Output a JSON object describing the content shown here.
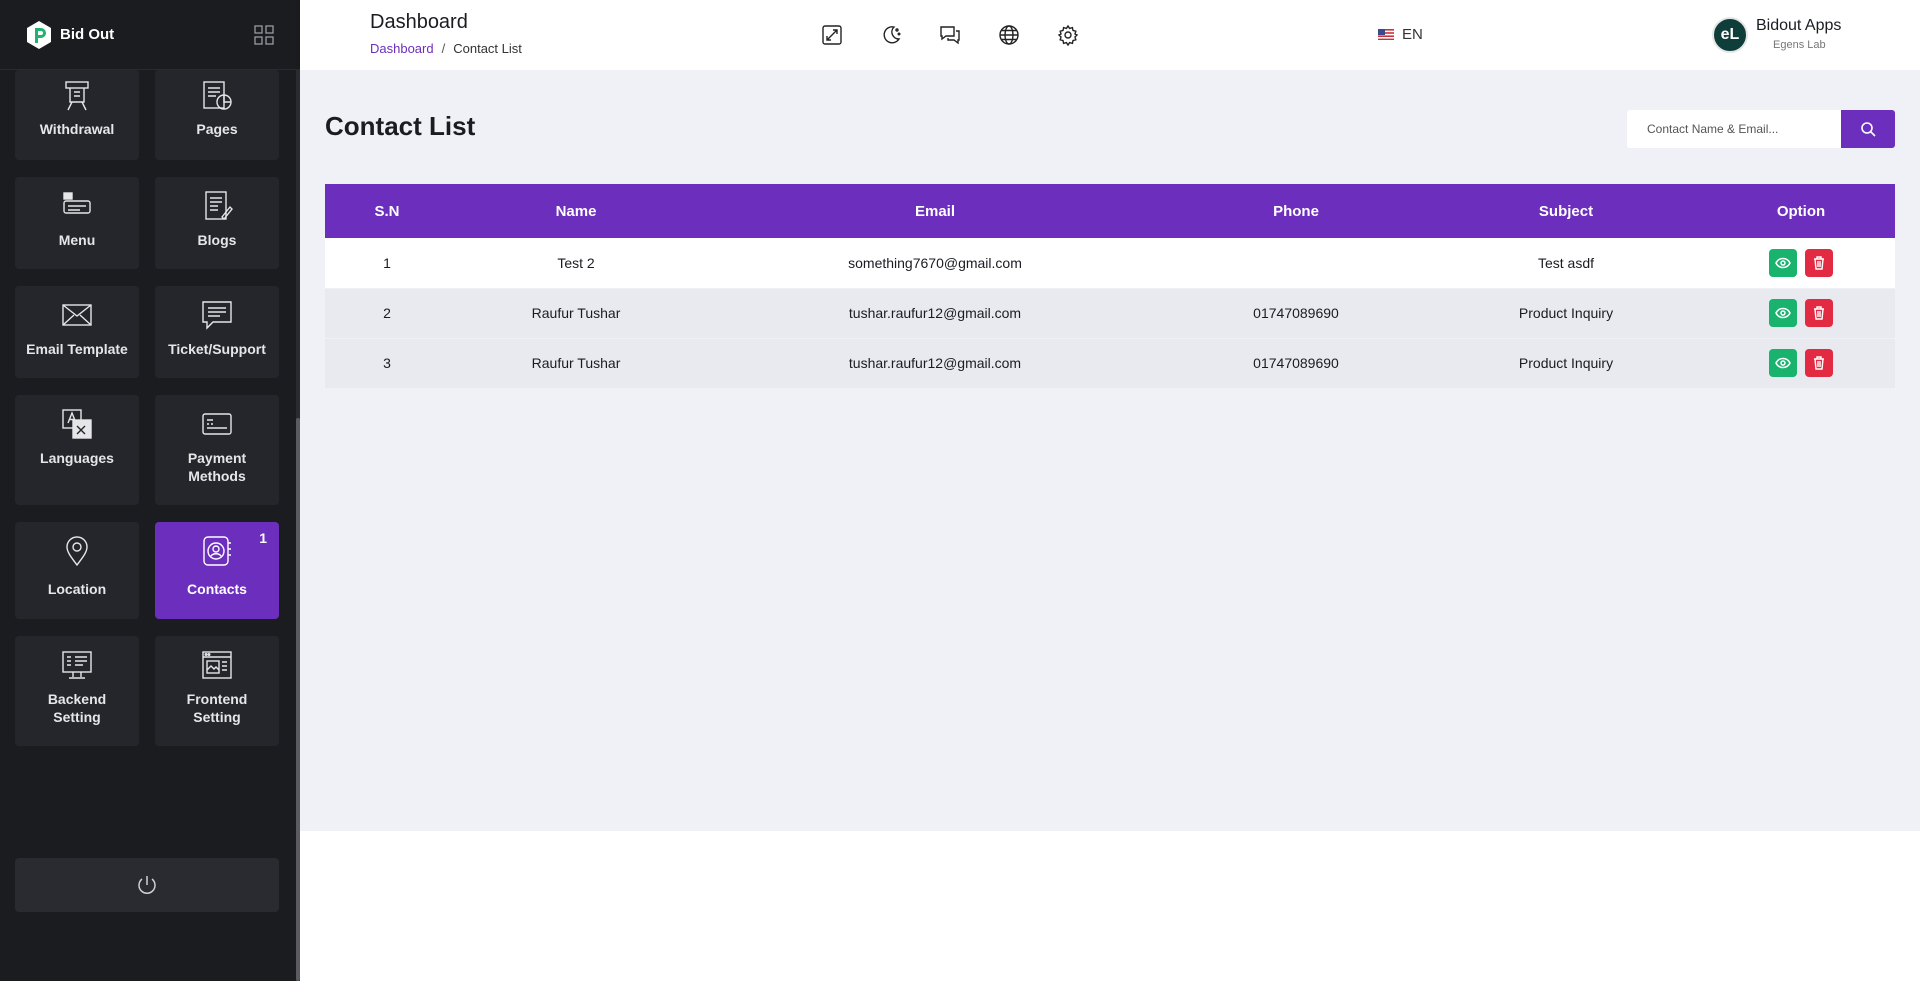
{
  "brand": {
    "name": "Bid Out"
  },
  "sidebar": {
    "tiles": [
      {
        "label": "Withdrawal",
        "icon": "withdrawal-icon"
      },
      {
        "label": "Pages",
        "icon": "pages-icon"
      },
      {
        "label": "Menu",
        "icon": "menu-icon"
      },
      {
        "label": "Blogs",
        "icon": "blogs-icon"
      },
      {
        "label": "Email Template",
        "icon": "email-icon"
      },
      {
        "label": "Ticket/Support",
        "icon": "ticket-icon"
      },
      {
        "label": "Languages",
        "icon": "languages-icon"
      },
      {
        "label": "Payment Methods",
        "icon": "payment-icon"
      },
      {
        "label": "Location",
        "icon": "location-icon"
      },
      {
        "label": "Contacts",
        "icon": "contacts-icon",
        "badge": "1",
        "active": true
      },
      {
        "label": "Backend Setting",
        "icon": "backend-setting-icon"
      },
      {
        "label": "Frontend Setting",
        "icon": "frontend-setting-icon"
      }
    ],
    "power_icon": "power-icon"
  },
  "header": {
    "title": "Dashboard",
    "breadcrumb": {
      "home": "Dashboard",
      "separator": "/",
      "current": "Contact List"
    },
    "icons": [
      "fullscreen-icon",
      "dark-mode-icon",
      "chat-icon",
      "globe-icon",
      "gear-icon"
    ],
    "language": "EN",
    "user": {
      "initials": "eL",
      "name": "Bidout Apps",
      "org": "Egens Lab"
    }
  },
  "main": {
    "title": "Contact List",
    "search": {
      "placeholder": "Contact Name & Email..."
    },
    "table": {
      "headers": [
        "S.N",
        "Name",
        "Email",
        "Phone",
        "Subject",
        "Option"
      ],
      "rows": [
        {
          "sn": "1",
          "name": "Test 2",
          "email": "something7670@gmail.com",
          "phone": "",
          "subject": "Test asdf"
        },
        {
          "sn": "2",
          "name": "Raufur Tushar",
          "email": "tushar.raufur12@gmail.com",
          "phone": "01747089690",
          "subject": "Product Inquiry"
        },
        {
          "sn": "3",
          "name": "Raufur Tushar",
          "email": "tushar.raufur12@gmail.com",
          "phone": "01747089690",
          "subject": "Product Inquiry"
        }
      ]
    }
  },
  "colors": {
    "accent": "#6c2ebc",
    "view": "#19b36e",
    "delete": "#e32a43",
    "sidebar": "#1b1c20"
  }
}
